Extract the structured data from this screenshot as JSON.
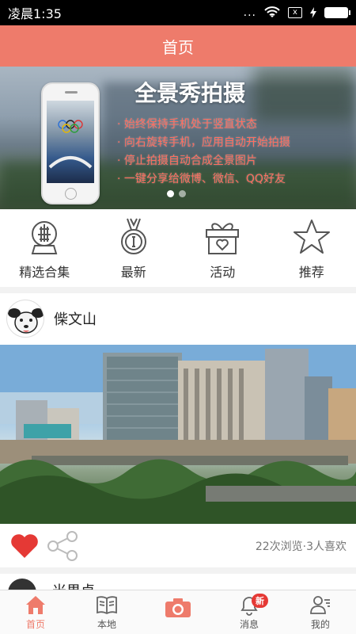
{
  "status_bar": {
    "time": "凌晨1:35",
    "dots": "...",
    "sim_label": "x"
  },
  "header": {
    "title": "首页"
  },
  "banner": {
    "title": "全景秀拍摄",
    "lines": [
      "· 始终保持手机处于竖直状态",
      "· 向右旋转手机，应用自动开始拍摄",
      "· 停止拍摄自动合成全景图片",
      "· 一键分享给微博、微信、QQ好友"
    ],
    "page_count": 2,
    "active_page": 0
  },
  "categories": [
    {
      "label": "精选合集",
      "icon": "snow-globe-icon"
    },
    {
      "label": "最新",
      "icon": "medal-icon"
    },
    {
      "label": "活动",
      "icon": "gift-icon"
    },
    {
      "label": "推荐",
      "icon": "star-icon"
    }
  ],
  "post": {
    "author": "偨文山",
    "stats": "22次浏览·3人喜欢",
    "like_icon": "heart-icon",
    "share_icon": "share-icon"
  },
  "next_post": {
    "author": "米果卓"
  },
  "tab_bar": {
    "items": [
      {
        "label": "首页",
        "icon": "home-icon",
        "active": true
      },
      {
        "label": "本地",
        "icon": "book-icon"
      },
      {
        "label": "",
        "icon": "camera-icon"
      },
      {
        "label": "消息",
        "icon": "bell-icon",
        "badge": "新"
      },
      {
        "label": "我的",
        "icon": "profile-icon"
      }
    ]
  },
  "colors": {
    "accent": "#ee7b6b",
    "like": "#e53935",
    "banner_text": "#ff6e60"
  }
}
